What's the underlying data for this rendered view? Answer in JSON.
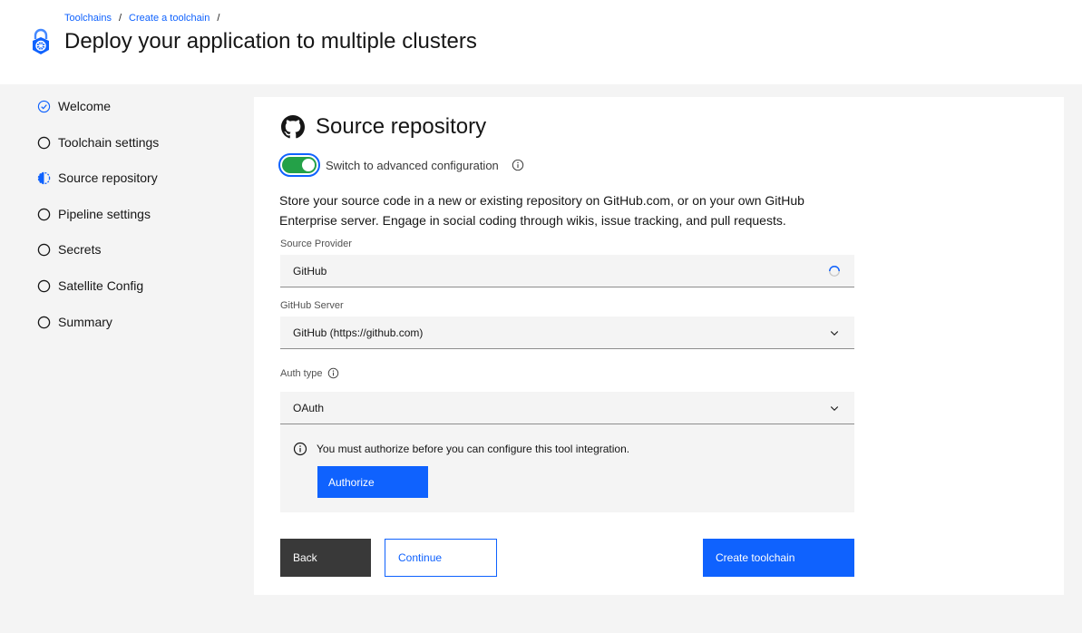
{
  "breadcrumb": {
    "items": [
      "Toolchains",
      "Create a toolchain"
    ],
    "separator": "/"
  },
  "header": {
    "title": "Deploy your application to multiple clusters",
    "icon": "toolchain-lock-icon"
  },
  "steps": [
    {
      "label": "Welcome",
      "state": "complete"
    },
    {
      "label": "Toolchain settings",
      "state": "incomplete"
    },
    {
      "label": "Source repository",
      "state": "current"
    },
    {
      "label": "Pipeline settings",
      "state": "incomplete"
    },
    {
      "label": "Secrets",
      "state": "incomplete"
    },
    {
      "label": "Satellite Config",
      "state": "incomplete"
    },
    {
      "label": "Summary",
      "state": "incomplete"
    }
  ],
  "section": {
    "title": "Source repository",
    "icon": "github-icon"
  },
  "toggle": {
    "label": "Switch to advanced configuration",
    "checked": true
  },
  "description": "Store your source code in a new or existing repository on GitHub.com, or on your own GitHub Enterprise server. Engage in social coding through wikis, issue tracking, and pull requests.",
  "fields": {
    "source_provider": {
      "label": "Source Provider",
      "value": "GitHub"
    },
    "github_server": {
      "label": "GitHub Server",
      "value": "GitHub (https://github.com)"
    },
    "auth_type": {
      "label": "Auth type",
      "value": "OAuth"
    }
  },
  "notice": {
    "text": "You must authorize before you can configure this tool integration.",
    "button": "Authorize"
  },
  "buttons": {
    "back": "Back",
    "continue": "Continue",
    "create": "Create toolchain"
  },
  "colors": {
    "primary": "#0f62fe",
    "toggle_on": "#24a148",
    "dark_button": "#393939",
    "field_bg": "#f4f4f4"
  }
}
